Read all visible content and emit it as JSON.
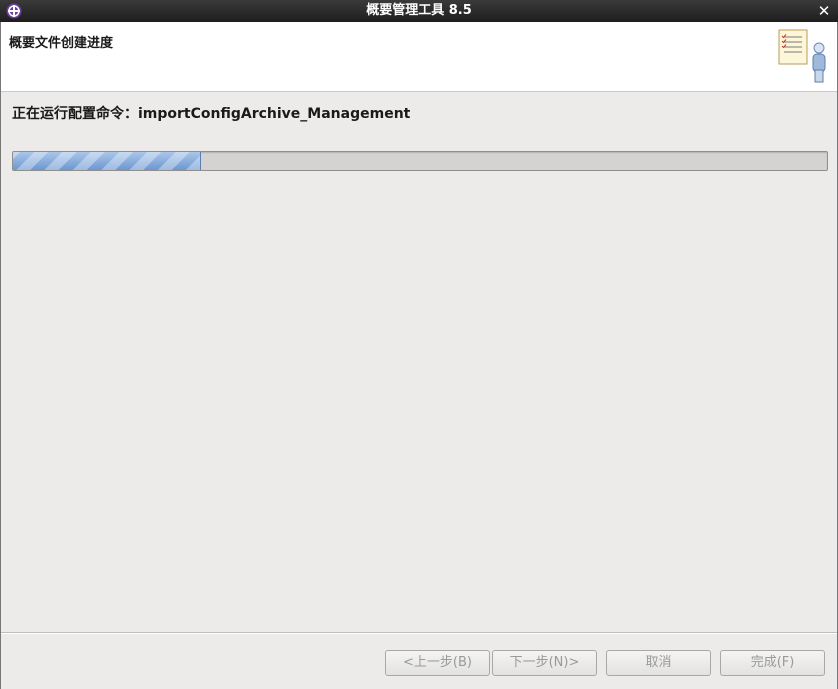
{
  "window": {
    "title": "概要管理工具 8.5"
  },
  "header": {
    "title": "概要文件创建进度"
  },
  "main": {
    "status": "正在运行配置命令：importConfigArchive_Management",
    "progress_fraction": 0.23
  },
  "buttons": {
    "back": "<上一步(B)",
    "next": "下一步(N)>",
    "cancel": "取消",
    "finish": "完成(F)"
  },
  "icons": {
    "app": "eclipse-plus-icon",
    "close": "close-icon",
    "wizard": "document-person-icon"
  }
}
